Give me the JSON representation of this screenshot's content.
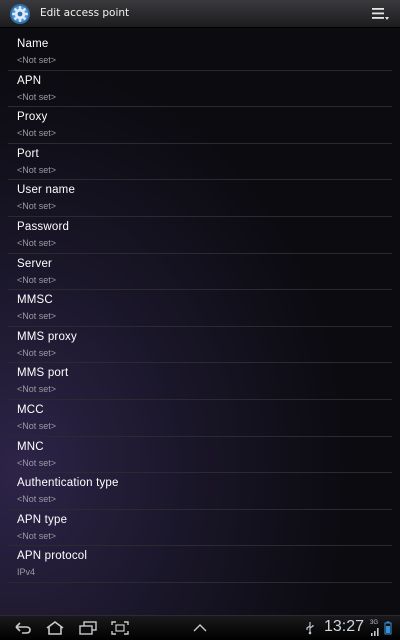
{
  "header": {
    "title": "Edit access point",
    "app_icon": "settings-gear-icon",
    "menu_icon": "overflow-menu-icon"
  },
  "fields": [
    {
      "label": "Name",
      "value": "<Not set>"
    },
    {
      "label": "APN",
      "value": "<Not set>"
    },
    {
      "label": "Proxy",
      "value": "<Not set>"
    },
    {
      "label": "Port",
      "value": "<Not set>"
    },
    {
      "label": "User name",
      "value": "<Not set>"
    },
    {
      "label": "Password",
      "value": "<Not set>"
    },
    {
      "label": "Server",
      "value": "<Not set>"
    },
    {
      "label": "MMSC",
      "value": "<Not set>"
    },
    {
      "label": "MMS proxy",
      "value": "<Not set>"
    },
    {
      "label": "MMS port",
      "value": "<Not set>"
    },
    {
      "label": "MCC",
      "value": "<Not set>"
    },
    {
      "label": "MNC",
      "value": "<Not set>"
    },
    {
      "label": "Authentication type",
      "value": "<Not set>"
    },
    {
      "label": "APN type",
      "value": "<Not set>"
    },
    {
      "label": "APN protocol",
      "value": "IPv4"
    }
  ],
  "navbar": {
    "time": "13:27",
    "network_label": "3G",
    "buttons": [
      "back-icon",
      "home-icon",
      "recent-apps-icon",
      "screenshot-icon",
      "notifications-up-icon"
    ]
  },
  "colors": {
    "accent": "#3b8fd9",
    "background": "#0b0b0f",
    "value_text": "#9c9ca4"
  }
}
